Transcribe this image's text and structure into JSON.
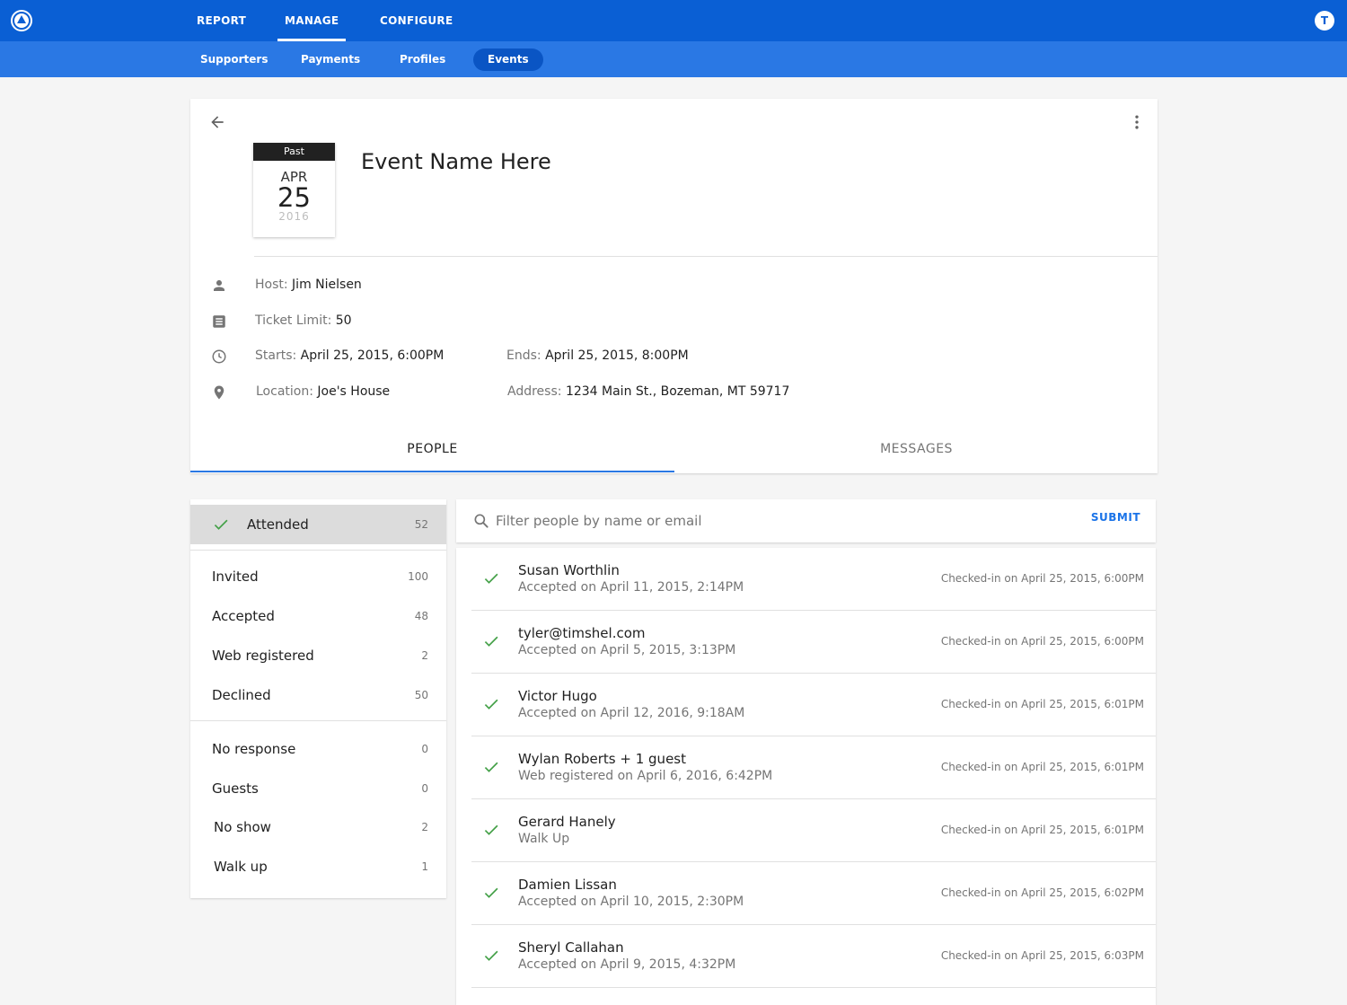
{
  "topnav": {
    "items": [
      {
        "label": "REPORT"
      },
      {
        "label": "MANAGE"
      },
      {
        "label": "CONFIGURE"
      }
    ],
    "avatar_initial": "T"
  },
  "subnav": {
    "items": [
      {
        "label": "Supporters"
      },
      {
        "label": "Payments"
      },
      {
        "label": "Profiles"
      },
      {
        "label": "Events"
      }
    ]
  },
  "event": {
    "status": "Past",
    "month": "APR",
    "day": "25",
    "year": "2016",
    "title": "Event Name Here",
    "host_label": "Host:",
    "host": "Jim Nielsen",
    "ticket_label": "Ticket Limit:",
    "ticket_limit": "50",
    "starts_label": "Starts:",
    "starts": "April 25, 2015, 6:00PM",
    "ends_label": "Ends:",
    "ends": "April 25, 2015, 8:00PM",
    "location_label": "Location:",
    "location": "Joe's House",
    "address_label": "Address:",
    "address": "1234 Main St., Bozeman, MT 59717"
  },
  "tabs": {
    "people": "PEOPLE",
    "messages": "MESSAGES"
  },
  "filters": [
    {
      "label": "Attended",
      "count": "52"
    },
    {
      "label": "Invited",
      "count": "100"
    },
    {
      "label": "Accepted",
      "count": "48"
    },
    {
      "label": "Web registered",
      "count": "2"
    },
    {
      "label": "Declined",
      "count": "50"
    },
    {
      "label": "No response",
      "count": "0"
    },
    {
      "label": "Guests",
      "count": "0"
    },
    {
      "label": "No show",
      "count": "2"
    },
    {
      "label": "Walk up",
      "count": "1"
    }
  ],
  "search": {
    "placeholder": "Filter people by name or email",
    "value": "",
    "submit_label": "SUBMIT"
  },
  "people": [
    {
      "name": "Susan Worthlin",
      "status": "Accepted on April 11, 2015, 2:14PM",
      "checkin": "Checked-in on April 25, 2015, 6:00PM"
    },
    {
      "name": "tyler@timshel.com",
      "status": "Accepted on April 5, 2015, 3:13PM",
      "checkin": "Checked-in on April 25, 2015, 6:00PM"
    },
    {
      "name": "Victor Hugo",
      "status": "Accepted on April 12, 2016, 9:18AM",
      "checkin": "Checked-in on April 25, 2015, 6:01PM"
    },
    {
      "name": "Wylan Roberts + 1 guest",
      "status": "Web registered on April 6, 2016, 6:42PM",
      "checkin": "Checked-in on April 25, 2015, 6:01PM"
    },
    {
      "name": "Gerard Hanely",
      "status": "Walk Up",
      "checkin": "Checked-in on April 25, 2015, 6:01PM"
    },
    {
      "name": "Damien Lissan",
      "status": "Accepted on April 10, 2015, 2:30PM",
      "checkin": "Checked-in on April 25, 2015, 6:02PM"
    },
    {
      "name": "Sheryl Callahan",
      "status": "Accepted on April 9, 2015, 4:32PM",
      "checkin": "Checked-in on April 25, 2015, 6:03PM"
    }
  ],
  "colors": {
    "topbar": "#0a5fd4",
    "subbar": "#2a78e4",
    "accent": "#1a73e8",
    "check": "#43a047"
  }
}
